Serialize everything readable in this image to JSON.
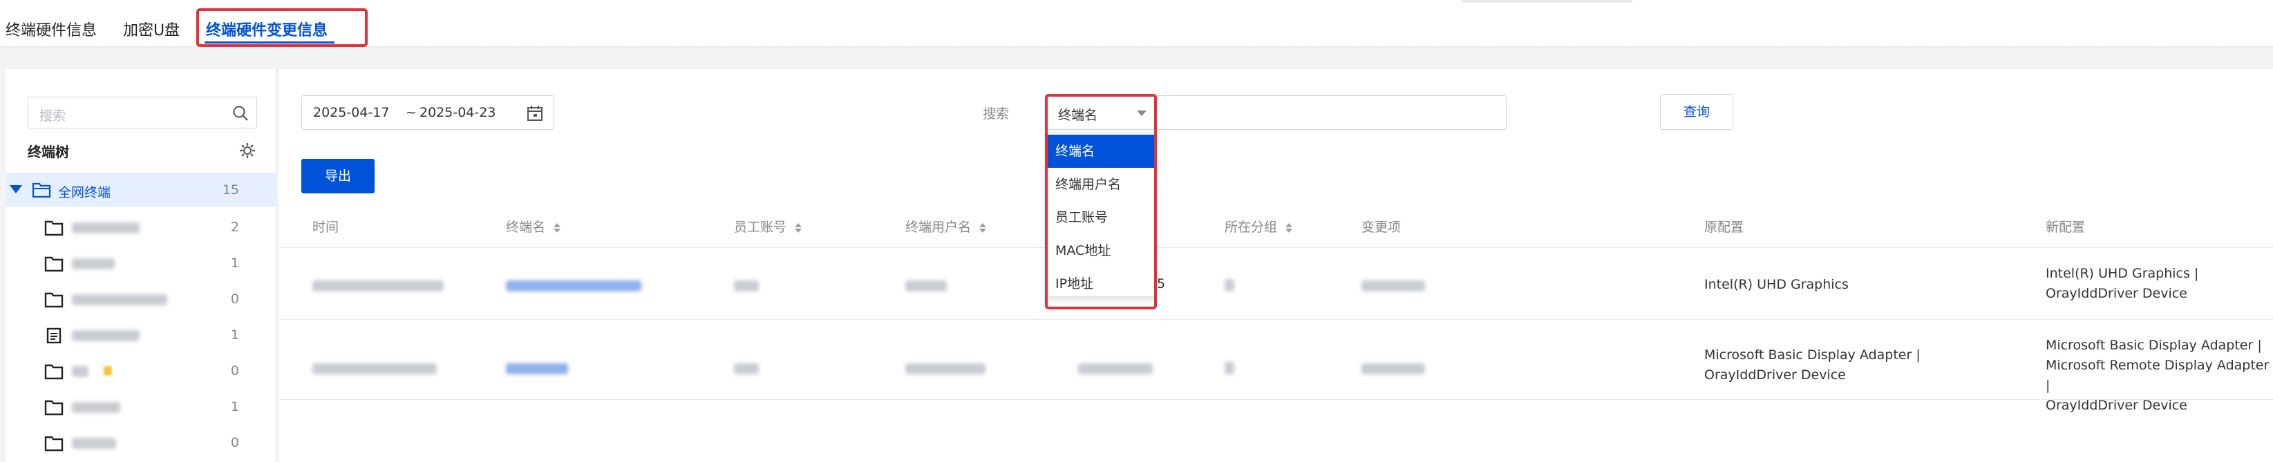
{
  "top_tabs": [
    {
      "label": "终端硬件信息"
    },
    {
      "label": "加密U盘"
    },
    {
      "label": "终端硬件变更信息",
      "active": true
    }
  ],
  "sidebar": {
    "search_placeholder": "搜索",
    "tree_title": "终端树",
    "root": {
      "label": "全网终端",
      "count": "15"
    },
    "items": [
      {
        "icon": "folder-icon",
        "count": "2"
      },
      {
        "icon": "folder-icon",
        "count": "1"
      },
      {
        "icon": "folder-icon",
        "count": "0"
      },
      {
        "icon": "document-icon",
        "count": "1"
      },
      {
        "icon": "folder-icon",
        "count": "0"
      },
      {
        "icon": "folder-icon",
        "count": "1"
      },
      {
        "icon": "folder-icon",
        "count": "0"
      }
    ]
  },
  "filters": {
    "date_start": "2025-04-17",
    "date_sep": "~",
    "date_end": "2025-04-23",
    "search_label": "搜索",
    "search_field": "终端名",
    "search_options": [
      "终端名",
      "终端用户名",
      "员工账号",
      "MAC地址",
      "IP地址"
    ],
    "selected_option_index": 0,
    "query_label": "查询",
    "export_label": "导出"
  },
  "table": {
    "columns": [
      "时间",
      "终端名",
      "员工账号",
      "终端用户名",
      "所在分组",
      "变更项",
      "原配置",
      "新配置"
    ],
    "rows": [
      {
        "partial_ip_suffix": "5",
        "old_config": [
          "Intel(R) UHD Graphics"
        ],
        "new_config": [
          "Intel(R) UHD Graphics |",
          "OrayIddDriver Device"
        ]
      },
      {
        "old_config": [
          "Microsoft Basic Display Adapter |",
          "OrayIddDriver Device"
        ],
        "new_config": [
          "Microsoft Basic Display Adapter |",
          "Microsoft Remote Display Adapter |",
          "OrayIddDriver Device"
        ]
      }
    ]
  },
  "colors": {
    "accent": "#0052d9",
    "highlight_box": "#e0323c"
  }
}
